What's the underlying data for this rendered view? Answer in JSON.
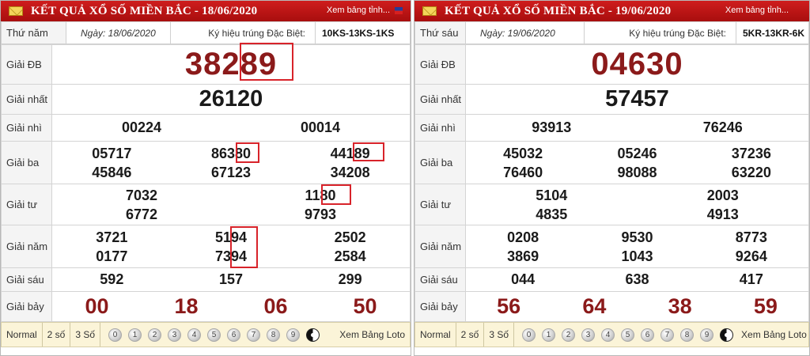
{
  "left": {
    "title": "KẾT QUẢ XỔ SỐ MIỀN BẮC - 18/06/2020",
    "link": "Xem bảng tỉnh...",
    "day": "Thứ năm",
    "date": "Ngày: 18/06/2020",
    "special_symbol_label": "Ký hiệu trúng Đặc Biệt:",
    "special_symbol": "10KS-13KS-1KS",
    "labels": [
      "Giải ĐB",
      "Giải nhất",
      "Giải nhì",
      "Giải ba",
      "Giải tư",
      "Giải năm",
      "Giải sáu",
      "Giải bảy"
    ],
    "prizes": {
      "db": "38289",
      "nhat": "26120",
      "nhi": [
        "00224",
        "00014"
      ],
      "ba": [
        "05717",
        "86380",
        "44189",
        "45846",
        "67123",
        "34208"
      ],
      "tu": [
        "7032",
        "1180",
        "6772",
        "9793"
      ],
      "nam": [
        "3721",
        "5194",
        "2502",
        "0177",
        "7394",
        "2584"
      ],
      "sau": [
        "592",
        "157",
        "299"
      ],
      "bay": [
        "00",
        "18",
        "06",
        "50"
      ]
    },
    "footer": {
      "normal": "Normal",
      "two": "2 số",
      "three": "3 Số",
      "balls": [
        "0",
        "1",
        "2",
        "3",
        "4",
        "5",
        "6",
        "7",
        "8",
        "9"
      ],
      "loto": "Xem Bảng Loto"
    }
  },
  "right": {
    "title": "KẾT QUẢ XỔ SỐ MIỀN BẮC - 19/06/2020",
    "link": "Xem bảng tỉnh...",
    "day": "Thứ sáu",
    "date": "Ngày: 19/06/2020",
    "special_symbol_label": "Ký hiệu trúng Đặc Biệt:",
    "special_symbol": "5KR-13KR-6K",
    "labels": [
      "Giải ĐB",
      "Giải nhất",
      "Giải nhì",
      "Giải ba",
      "Giải tư",
      "Giải năm",
      "Giải sáu",
      "Giải bảy"
    ],
    "prizes": {
      "db": "04630",
      "nhat": "57457",
      "nhi": [
        "93913",
        "76246"
      ],
      "ba": [
        "45032",
        "05246",
        "37236",
        "76460",
        "98088",
        "63220"
      ],
      "tu": [
        "5104",
        "2003",
        "4835",
        "4913"
      ],
      "nam": [
        "0208",
        "9530",
        "8773",
        "3869",
        "1043",
        "9264"
      ],
      "sau": [
        "044",
        "638",
        "417"
      ],
      "bay": [
        "56",
        "64",
        "38",
        "59"
      ]
    },
    "footer": {
      "normal": "Normal",
      "two": "2 số",
      "three": "3 Số",
      "balls": [
        "0",
        "1",
        "2",
        "3",
        "4",
        "5",
        "6",
        "7",
        "8",
        "9"
      ],
      "loto": "Xem Bảng Loto"
    }
  },
  "colors": {
    "header": "#b5121b",
    "special": "#8b1a1a",
    "highlight": "#d8232a",
    "footer": "#fbf4d8"
  }
}
